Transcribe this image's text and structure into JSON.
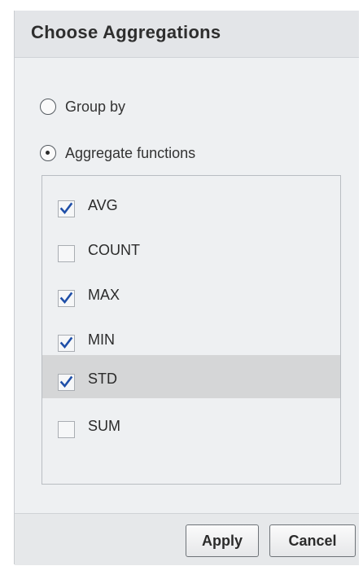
{
  "dialog": {
    "title": "Choose Aggregations"
  },
  "mode": {
    "options": [
      {
        "label": "Group by",
        "selected": false
      },
      {
        "label": "Aggregate functions",
        "selected": true
      }
    ]
  },
  "functions": {
    "items": [
      {
        "label": "AVG",
        "checked": true
      },
      {
        "label": "COUNT",
        "checked": false
      },
      {
        "label": "MAX",
        "checked": true
      },
      {
        "label": "MIN",
        "checked": true
      },
      {
        "label": "STD",
        "checked": true,
        "highlighted": true
      },
      {
        "label": "SUM",
        "checked": false
      }
    ]
  },
  "footer": {
    "apply_label": "Apply",
    "cancel_label": "Cancel"
  },
  "colors": {
    "check_mark": "#1f4fa8",
    "highlight_row": "#d5d6d7",
    "dialog_bg": "#eef0f2"
  }
}
